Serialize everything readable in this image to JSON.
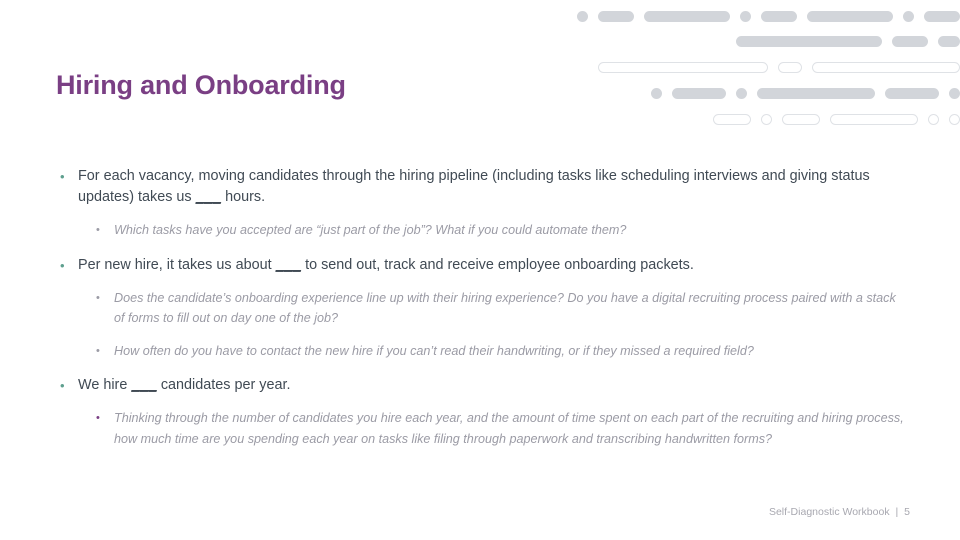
{
  "slide": {
    "title": "Hiring and Onboarding",
    "bullet_marker": "•",
    "blank_fill": "___",
    "colors": {
      "title_purple": "#7a3f84",
      "body_text": "#404a54",
      "sub_text": "#9b9ba5",
      "bullet_teal": "#5e9f8e",
      "bullet_purple": "#7a3f84",
      "deco_gray": "#d2d5da",
      "deco_outline": "#dfe2e6",
      "background": "#ffffff"
    }
  },
  "body": {
    "items": [
      {
        "level": 1,
        "marker_color": "teal",
        "text": "For each vacancy, moving candidates through the hiring pipeline (including tasks like scheduling interviews and giving status updates) takes us ___ hours."
      },
      {
        "level": 2,
        "marker_color": "gray",
        "text": "Which tasks have you accepted are “just part of the job”? What if you could automate them?"
      },
      {
        "level": 1,
        "marker_color": "teal",
        "text": "Per new hire, it takes us about ___ to send out, track and receive  employee onboarding packets."
      },
      {
        "level": 2,
        "marker_color": "gray",
        "text": "Does the candidate’s onboarding experience line up with their hiring experience? Do you have a digital recruiting process paired with a stack of forms to fill out on day one of the job?"
      },
      {
        "level": 2,
        "marker_color": "gray",
        "text": " How often do you have to contact the new hire if you can’t read their handwriting, or if they missed a required field?"
      },
      {
        "level": 1,
        "marker_color": "teal",
        "text": "We hire ___ candidates per year."
      },
      {
        "level": 2,
        "marker_color": "purple",
        "text": "Thinking through the number of candidates you hire each year, and the amount of time spent on each part of the recruiting and hiring process, how much time are you spending each year on tasks like filing through paperwork and transcribing handwritten forms?"
      }
    ]
  },
  "footer": {
    "workbook_label": "Self-Diagnostic Workbook",
    "separator": "|",
    "page_number": "5"
  },
  "decoration": {
    "rows": [
      {
        "shapes": [
          "dot",
          "sm",
          "lg",
          "dot",
          "sm",
          "lg",
          "dot",
          "sm"
        ],
        "style": "filled"
      },
      {
        "shapes": [
          "xxl",
          "sm",
          "xs"
        ],
        "style": "filled"
      },
      {
        "shapes": [
          "huge",
          "xs",
          "xxl"
        ],
        "style": "hollow"
      },
      {
        "shapes": [
          "dot",
          "md",
          "dot",
          "xl",
          "md",
          "dot"
        ],
        "style": "filled"
      },
      {
        "shapes": [
          "sm",
          "dot",
          "sm",
          "lg",
          "dot",
          "dot"
        ],
        "style": "hollow"
      }
    ]
  }
}
